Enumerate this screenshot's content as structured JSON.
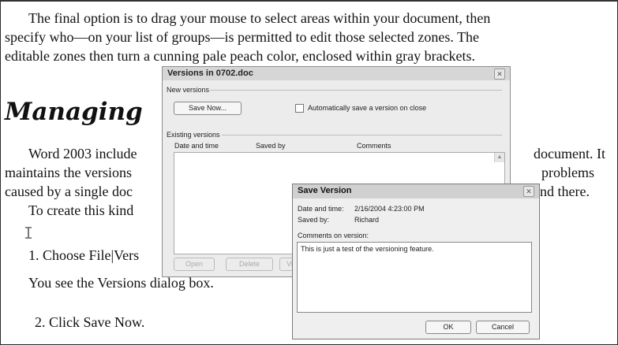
{
  "document": {
    "para1": [
      "The final option is to drag your mouse to select areas within your document, then",
      "specify who—on your list of groups—is permitted to edit those selected zones. The",
      "editable zones then turn a cunning pale peach color, enclosed within gray brackets."
    ],
    "heading": "Managing",
    "para2": [
      "Word 2003 include",
      "maintains the versions",
      "caused by a single doc",
      "To create this kind"
    ],
    "para2_right": [
      "document. It",
      "problems",
      "nd there."
    ],
    "step1": "1. Choose File|Vers",
    "step1_result": "You see the Versions dialog box.",
    "step2": "2.  Click Save Now."
  },
  "versions_dialog": {
    "title": "Versions in 0702.doc",
    "new_versions_label": "New versions",
    "save_now_label": "Save Now...",
    "auto_save_label": "Automatically save a version on close",
    "existing_versions_label": "Existing versions",
    "columns": [
      "Date and time",
      "Saved by",
      "Comments"
    ],
    "buttons": [
      "Open",
      "Delete",
      "Vi"
    ]
  },
  "save_version_dialog": {
    "title": "Save Version",
    "date_time_label": "Date and time:",
    "date_time_value": "2/16/2004 4:23:00 PM",
    "saved_by_label": "Saved by:",
    "saved_by_value": "Richard",
    "comments_label": "Comments on version:",
    "comments_value": "This is just a test of the versioning feature.",
    "ok_label": "OK",
    "cancel_label": "Cancel"
  }
}
